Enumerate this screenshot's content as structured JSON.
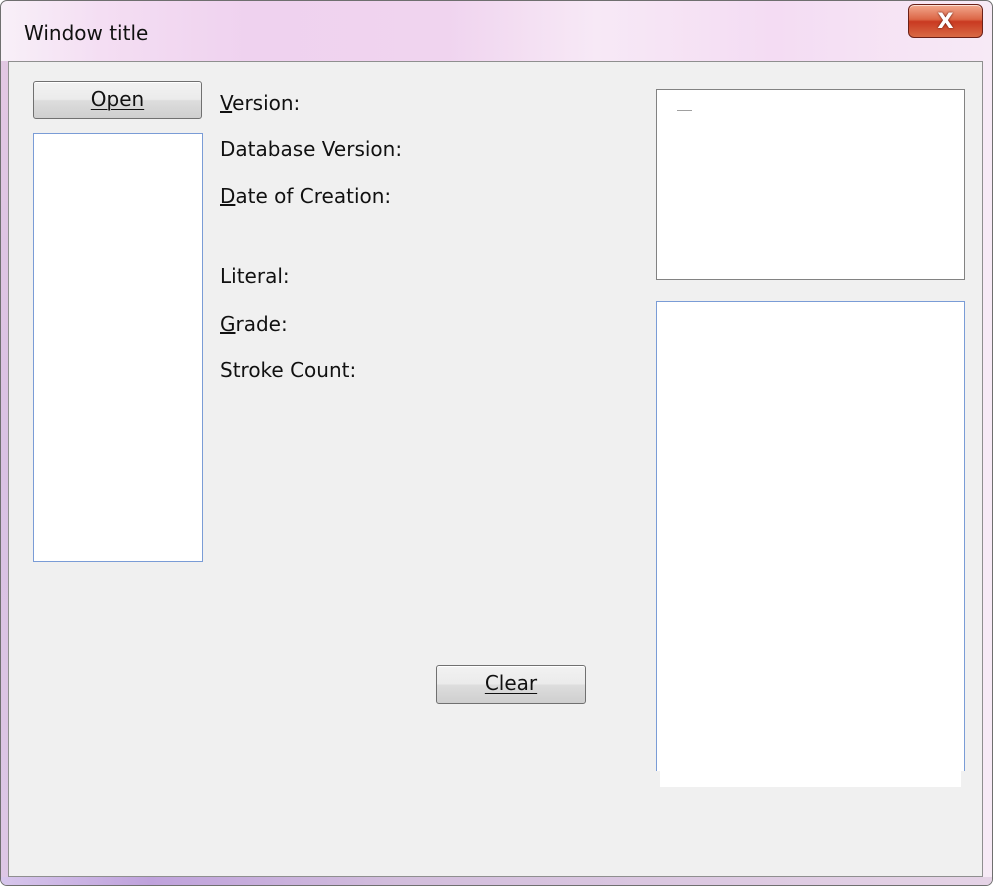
{
  "window": {
    "title": "Window title",
    "close_icon": "close-icon",
    "close_symbol": "X"
  },
  "buttons": {
    "open_label": "Open",
    "clear_label": "Clear"
  },
  "labels": {
    "version": "Version:",
    "database_version": "Database Version:",
    "date_of_creation": "Date of Creation:",
    "literal": "Literal:",
    "grade": "Grade:",
    "stroke_count": "Stroke Count:"
  },
  "colors": {
    "close_button": "#d9553a",
    "list_border": "#7a9cd6",
    "client_background": "#f0f0f0"
  }
}
